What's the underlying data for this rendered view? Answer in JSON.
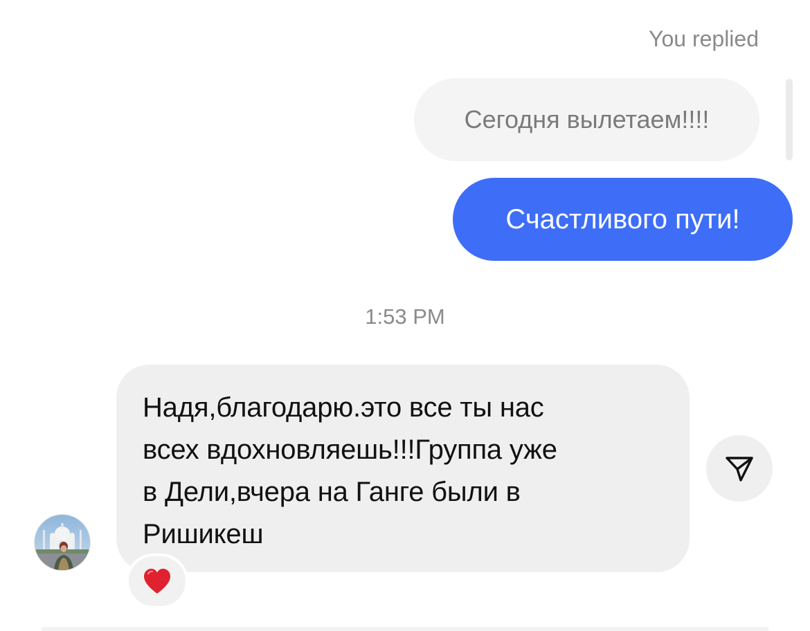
{
  "thread": {
    "replied_label": "You replied",
    "quoted_message": "Сегодня вылетаем!!!!",
    "sent_message": "Счастливого пути!",
    "timestamp": "1:53 PM",
    "received_message": {
      "lines": [
        "Надя,благодарю.это все ты нас",
        "всех вдохновляешь!!!Группа уже",
        "в Дели,вчера на Ганге были в",
        "Ришикеш"
      ],
      "reaction": "❤️"
    }
  },
  "colors": {
    "sent_bubble": "#3e6ef7",
    "received_bubble": "#efefef",
    "quoted_bubble": "#f4f4f4",
    "secondary_text": "#8a8a8a",
    "heart": "#e0212f"
  },
  "icons": {
    "share": "paper-plane-icon",
    "reaction": "red-heart-icon",
    "avatar": "profile-photo"
  }
}
